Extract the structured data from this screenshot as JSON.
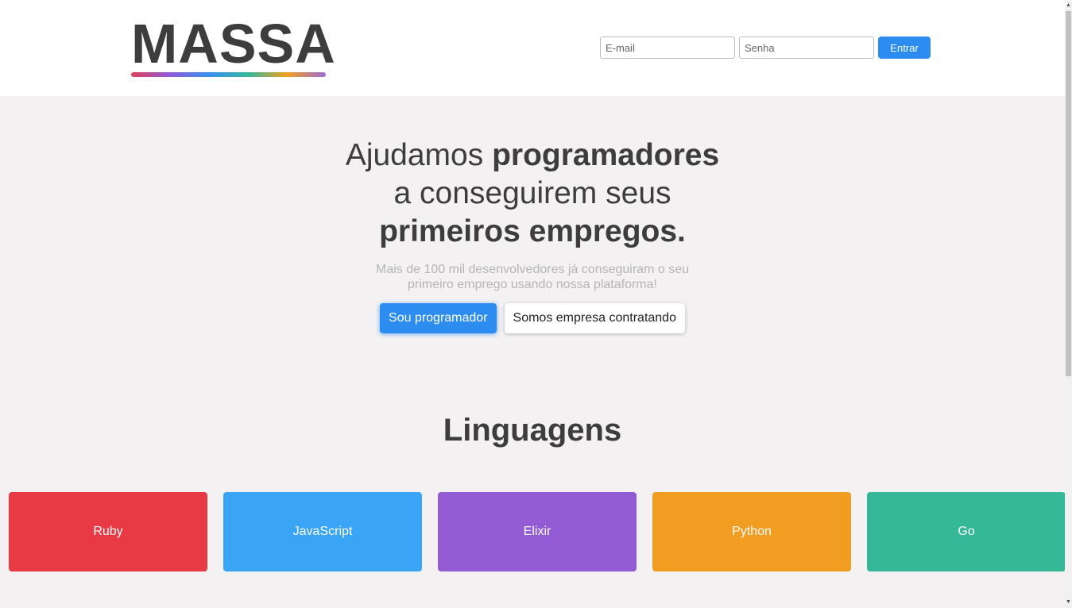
{
  "header": {
    "logo_text": "MASSA",
    "logo_gradient": [
      "#e0405a",
      "#8f5ad6",
      "#3b8ff0",
      "#33b89a",
      "#f0a020",
      "#9b6bd6"
    ],
    "email_placeholder": "E-mail",
    "password_placeholder": "Senha",
    "login_label": "Entrar"
  },
  "hero": {
    "line1_normal": "Ajudamos ",
    "line1_bold": "programadores",
    "line2": "a conseguirem seus",
    "line3_bold": "primeiros empregos.",
    "subtitle": "Mais de 100 mil desenvolvedores já conseguiram o seu primeiro emprego usando nossa plataforma!",
    "primary_cta": "Sou programador",
    "secondary_cta": "Somos empresa contratando"
  },
  "languages": {
    "title": "Linguagens",
    "items": [
      {
        "label": "Ruby",
        "color": "#e83a45"
      },
      {
        "label": "JavaScript",
        "color": "#3aa5f5"
      },
      {
        "label": "Elixir",
        "color": "#935bd4"
      },
      {
        "label": "Python",
        "color": "#f09d22"
      },
      {
        "label": "Go",
        "color": "#35b898"
      }
    ]
  },
  "colors": {
    "accent": "#2d8cf0",
    "text_dark": "#3d3d3d",
    "background": "#f3f1f2"
  }
}
